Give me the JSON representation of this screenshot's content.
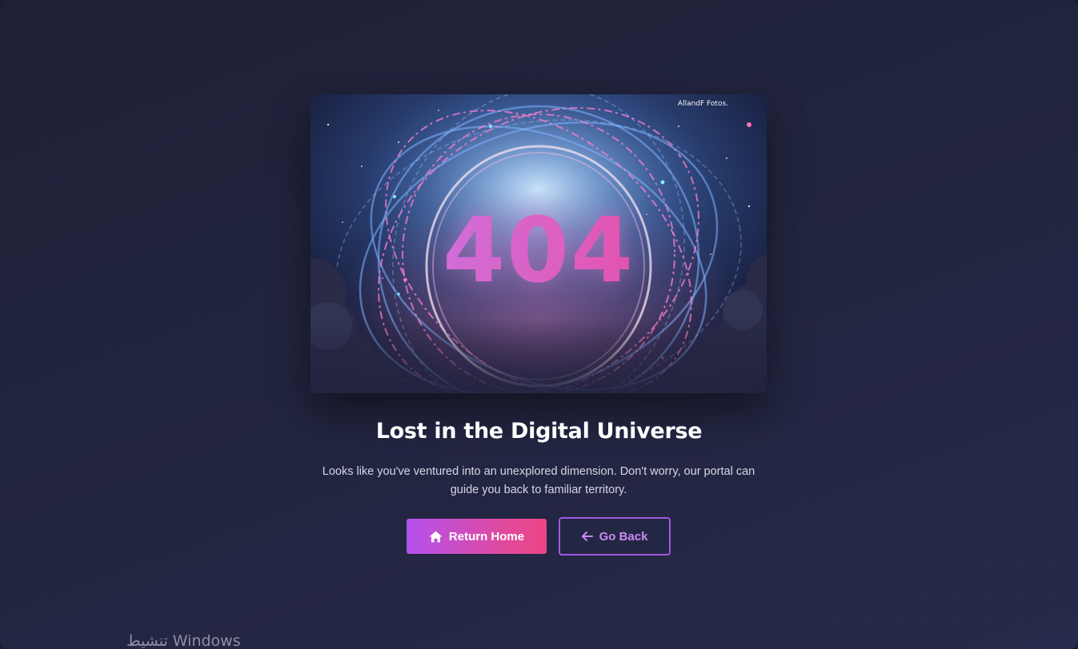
{
  "hero": {
    "code": "404",
    "image_caption": "AllandF Fotos."
  },
  "main": {
    "title": "Lost in the Digital Universe",
    "description": "Looks like you've ventured into an unexplored dimension. Don't worry, our portal can guide you back to familiar territory."
  },
  "actions": {
    "return_home_label": "Return Home",
    "return_home_icon": "home-icon",
    "go_back_label": "Go Back",
    "go_back_icon": "arrow-left-icon"
  },
  "os_overlay": {
    "activation_text": "تنشيط Windows"
  },
  "colors": {
    "background": "#21233c",
    "accent_start": "#b351ee",
    "accent_end": "#ee4488",
    "outline": "#9f58e2"
  }
}
